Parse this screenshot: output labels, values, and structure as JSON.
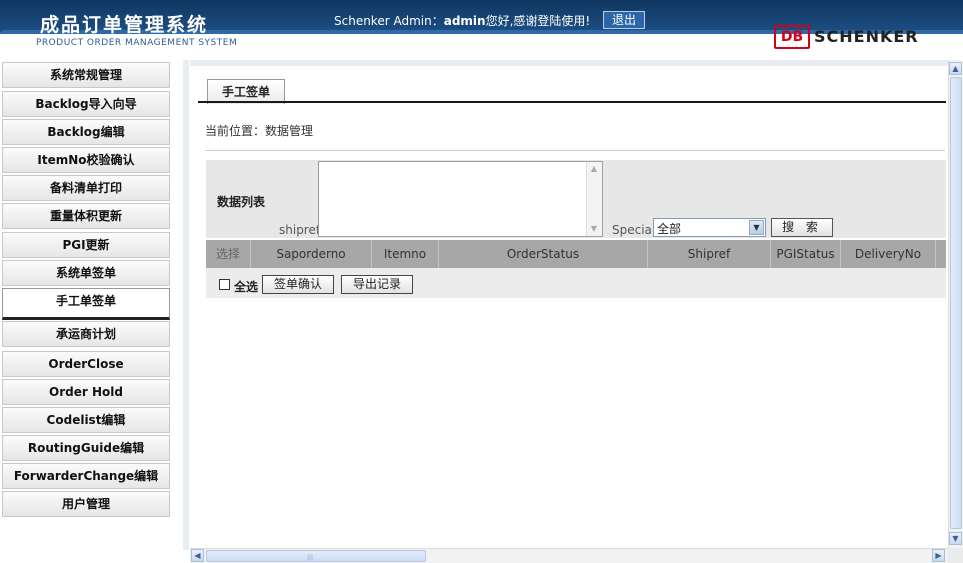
{
  "header": {
    "title": "成品订单管理系统",
    "subtitle": "PRODUCT ORDER MANAGEMENT SYSTEM",
    "greeting_prefix": "Schenker Admin：",
    "username": "admin",
    "greeting_suffix": "您好,感谢登陆使用!",
    "logout_label": "退出",
    "logo_db": "DB",
    "logo_text": "SCHENKER"
  },
  "sidebar": {
    "items": [
      {
        "label": "系统常规管理"
      },
      {
        "label": "Backlog导入向导"
      },
      {
        "label": "Backlog编辑"
      },
      {
        "label": "ItemNo校验确认"
      },
      {
        "label": "备料清单打印"
      },
      {
        "label": "重量体积更新"
      },
      {
        "label": "PGI更新"
      },
      {
        "label": "系统单签单"
      },
      {
        "label": "手工单签单",
        "active": true
      },
      {
        "label": "承运商计划"
      },
      {
        "label": "OrderClose"
      },
      {
        "label": "Order Hold"
      },
      {
        "label": "Codelist编辑"
      },
      {
        "label": "RoutingGuide编辑"
      },
      {
        "label": "ForwarderChange编辑"
      },
      {
        "label": "用户管理"
      }
    ]
  },
  "main": {
    "tab_label": "手工签单",
    "breadcrumb": "当前位置：数据管理",
    "search": {
      "list_label": "数据列表",
      "shipref_label": "shipref:",
      "shipref_value": "",
      "special_label": "Special:",
      "special_value": "全部",
      "search_button": "搜  索"
    },
    "table": {
      "columns": [
        "选择",
        "Saporderno",
        "Itemno",
        "OrderStatus",
        "Shipref",
        "PGIStatus",
        "DeliveryNo"
      ]
    },
    "actions": {
      "select_all_label": "全选",
      "sign_confirm_button": "签单确认",
      "export_button": "导出记录"
    }
  },
  "colors": {
    "header_blue": "#1d4f84",
    "logo_red": "#d4001a",
    "table_header_gray": "#a7a7a7"
  }
}
